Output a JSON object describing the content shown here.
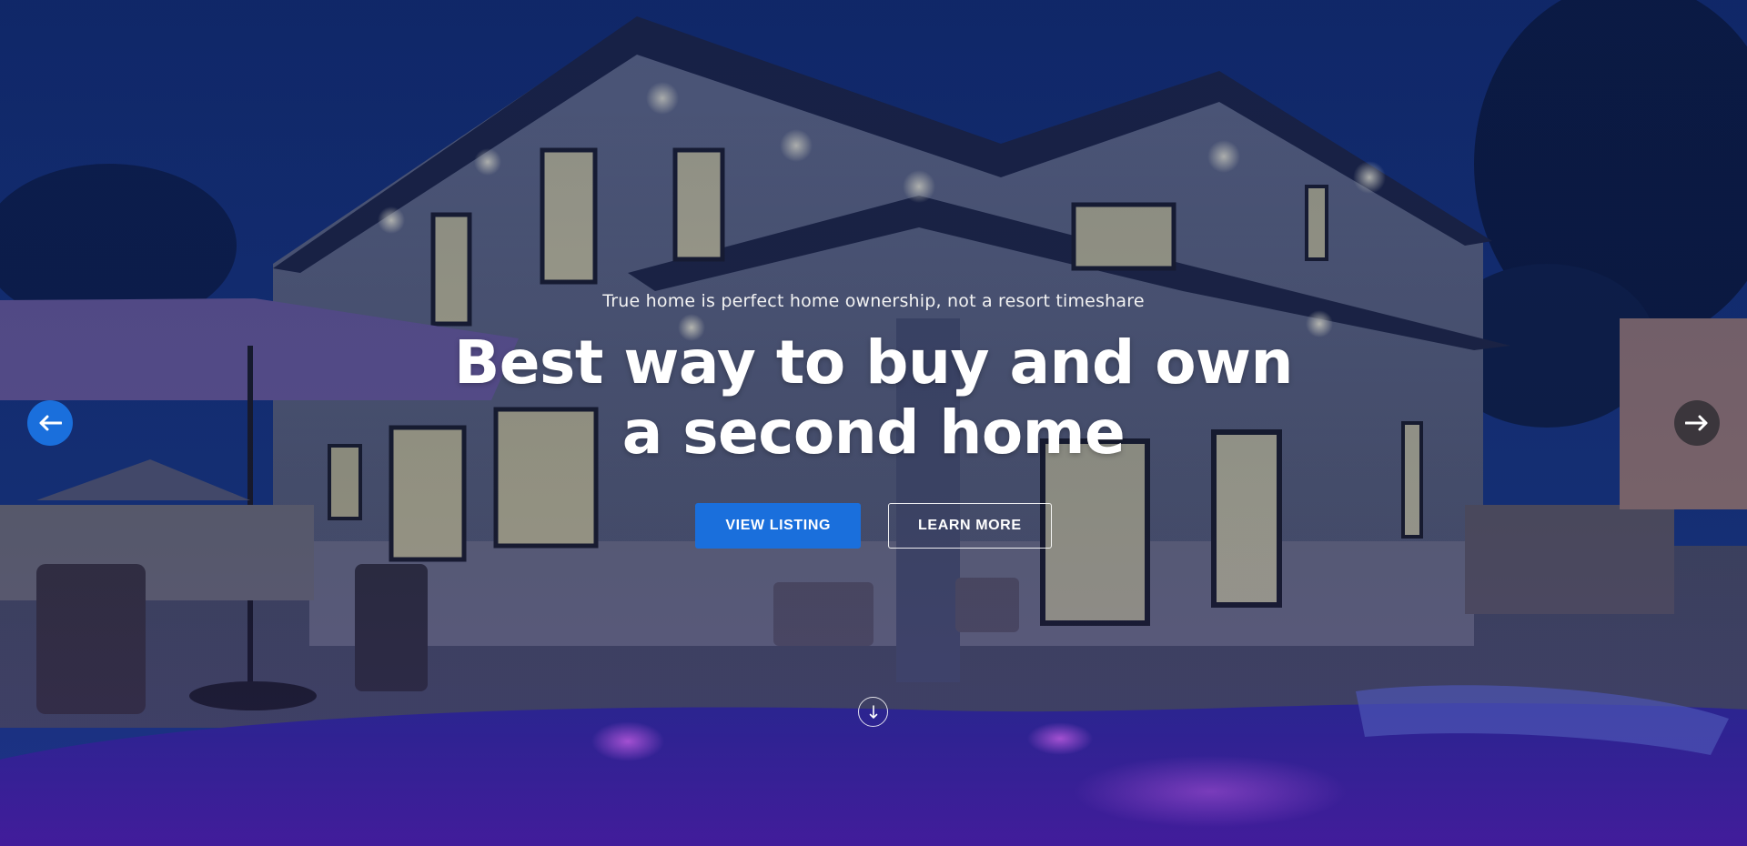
{
  "hero": {
    "tagline": "True home is perfect home ownership, not a resort timeshare",
    "headline_line1": "Best way to buy and own",
    "headline_line2": "a second home",
    "primary_cta_label": "VIEW LISTING",
    "secondary_cta_label": "LEARN MORE"
  },
  "carousel": {
    "prev_icon": "arrow-left-icon",
    "next_icon": "arrow-right-icon"
  },
  "scroll": {
    "icon": "arrow-down-icon"
  },
  "colors": {
    "accent": "#1a6fdc",
    "text": "#ffffff",
    "overlay": "#0f2a6b"
  }
}
